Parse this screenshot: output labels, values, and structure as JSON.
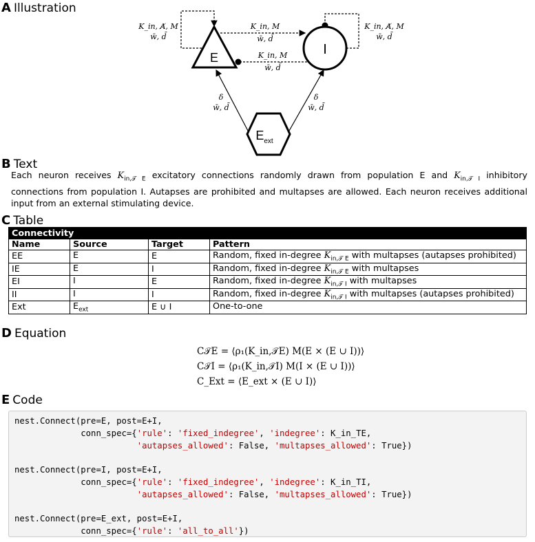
{
  "sections": {
    "a": {
      "letter": "A",
      "title": "Illustration"
    },
    "b": {
      "letter": "B",
      "title": "Text"
    },
    "c": {
      "letter": "C",
      "title": "Table"
    },
    "d": {
      "letter": "D",
      "title": "Equation"
    },
    "e": {
      "letter": "E",
      "title": "Code"
    }
  },
  "diagram": {
    "nodes": {
      "e": "E",
      "i": "I",
      "ext": "E",
      "ext_sub": "ext"
    },
    "labels": {
      "ee_top": "K_in, A̸, M",
      "ee_bot": "w̄, d̄",
      "ei_top": "K_in, M",
      "ei_bot": "w̄, d̄",
      "ie_top": "K_in, M",
      "ie_bot": "w̄, d̄",
      "ii_top": "K_in, A̸, M",
      "ii_bot": "w̄, d̄",
      "exte_top": "δ",
      "exte_bot": "w̄, d̄",
      "exti_top": "δ",
      "exti_bot": "w̄, d̄"
    }
  },
  "text": {
    "p1": "Each neuron receives ",
    "k1": "K",
    "k1s": "in,𝒯 E",
    "p2": " excitatory connections randomly drawn from population E and ",
    "k2": "K",
    "k2s": "in,𝒯 I",
    "p3": " inhibitory connections from population I. Autapses are prohibited and multapses are allowed. Each neuron receives additional input from an external stimulating device."
  },
  "table": {
    "caption": "Connectivity",
    "headers": [
      "Name",
      "Source",
      "Target",
      "Pattern"
    ],
    "rows": [
      {
        "name": "EE",
        "source": "E",
        "source_sub": "",
        "target": "E",
        "pre": "Random, fixed in-degree ",
        "k": "K",
        "ks": "in,𝒯 E",
        "post": " with multapses (autapses prohibited)"
      },
      {
        "name": "IE",
        "source": "E",
        "source_sub": "",
        "target": "I",
        "pre": "Random, fixed in-degree ",
        "k": "K",
        "ks": "in,𝒯 E",
        "post": " with multapses"
      },
      {
        "name": "EI",
        "source": "I",
        "source_sub": "",
        "target": "E",
        "pre": "Random, fixed in-degree ",
        "k": "K",
        "ks": "in,𝒯 I",
        "post": " with multapses"
      },
      {
        "name": "II",
        "source": "I",
        "source_sub": "",
        "target": "I",
        "pre": "Random, fixed in-degree ",
        "k": "K",
        "ks": "in,𝒯 I",
        "post": " with multapses (autapses prohibited)"
      },
      {
        "name": "Ext",
        "source": "E",
        "source_sub": "ext",
        "target": "E ∪ I",
        "pre": "One-to-one",
        "k": "",
        "ks": "",
        "post": ""
      }
    ]
  },
  "equations": [
    "C𝒯E = ⟨ρ₁(K_in,𝒯E) M(E × (E ∪ I))⟩",
    "C𝒯I = ⟨ρ₁(K_in,𝒯I) M(I × (E ∪ I))⟩",
    "C_Ext = ⟨E_ext × (E ∪ I)⟩"
  ],
  "code": {
    "l1": "nest.Connect(pre=E, post=E+I,",
    "l2a": "             conn_spec={",
    "l2b": "'rule'",
    "l2c": ": ",
    "l2d": "'fixed_indegree'",
    "l2e": ", ",
    "l2f": "'indegree'",
    "l2g": ": K_in_TE,",
    "l3a": "                        ",
    "l3b": "'autapses_allowed'",
    "l3c": ": False, ",
    "l3d": "'multapses_allowed'",
    "l3e": ": True})",
    "l4": "nest.Connect(pre=I, post=E+I,",
    "l5g": ": K_in_TI,",
    "l7": "nest.Connect(pre=E_ext, post=E+I,",
    "l8d": "'all_to_all'",
    "l8e": "})"
  }
}
